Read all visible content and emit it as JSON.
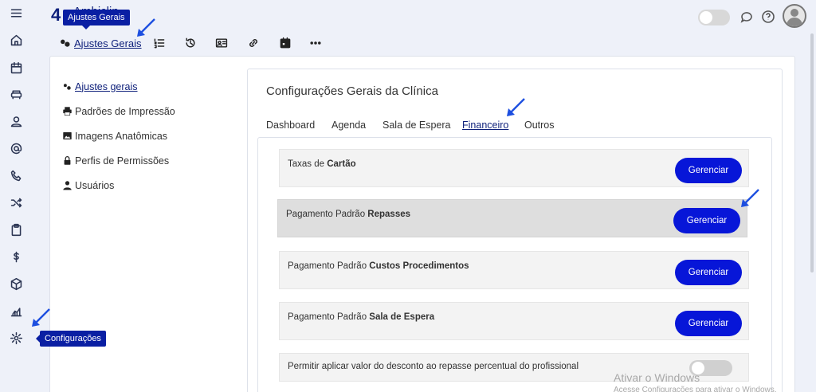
{
  "header": {
    "logo_text": "4",
    "logo_partial": "Ambiclin",
    "tooltip": "Ajustes Gerais"
  },
  "top_tabs": {
    "active_label": "Ajustes Gerais"
  },
  "side_menu": {
    "items": [
      {
        "label": "Ajustes gerais",
        "icon": "gears-icon"
      },
      {
        "label": "Padrões de Impressão",
        "icon": "printer-icon"
      },
      {
        "label": "Imagens Anatômicas",
        "icon": "image-icon"
      },
      {
        "label": "Perfis de Permissões",
        "icon": "lock-icon"
      },
      {
        "label": "Usuários",
        "icon": "user-icon"
      }
    ]
  },
  "config": {
    "title": "Configurações Gerais da Clínica",
    "tabs": [
      "Dashboard",
      "Agenda",
      "Sala de Espera",
      "Financeiro",
      "Outros"
    ],
    "rows": [
      {
        "prefix": "Taxas de ",
        "bold": "Cartão",
        "button": "Gerenciar"
      },
      {
        "prefix": "Pagamento Padrão ",
        "bold": "Repasses",
        "button": "Gerenciar"
      },
      {
        "prefix": "Pagamento Padrão ",
        "bold": "Custos Procedimentos",
        "button": "Gerenciar"
      },
      {
        "prefix": "Pagamento Padrão ",
        "bold": "Sala de Espera",
        "button": "Gerenciar"
      }
    ],
    "toggle_row": {
      "label": "Permitir aplicar valor do desconto ao repasse percentual do profissional"
    }
  },
  "rail_tooltip": "Configurações",
  "watermark": {
    "line1": "Ativar o Windows",
    "line2": "Acesse Configurações para ativar o Windows."
  },
  "colors": {
    "accent": "#0716d8",
    "tooltip": "#0a1fa3",
    "brand": "#0d1f7a",
    "arrow": "#1d4fe0"
  }
}
